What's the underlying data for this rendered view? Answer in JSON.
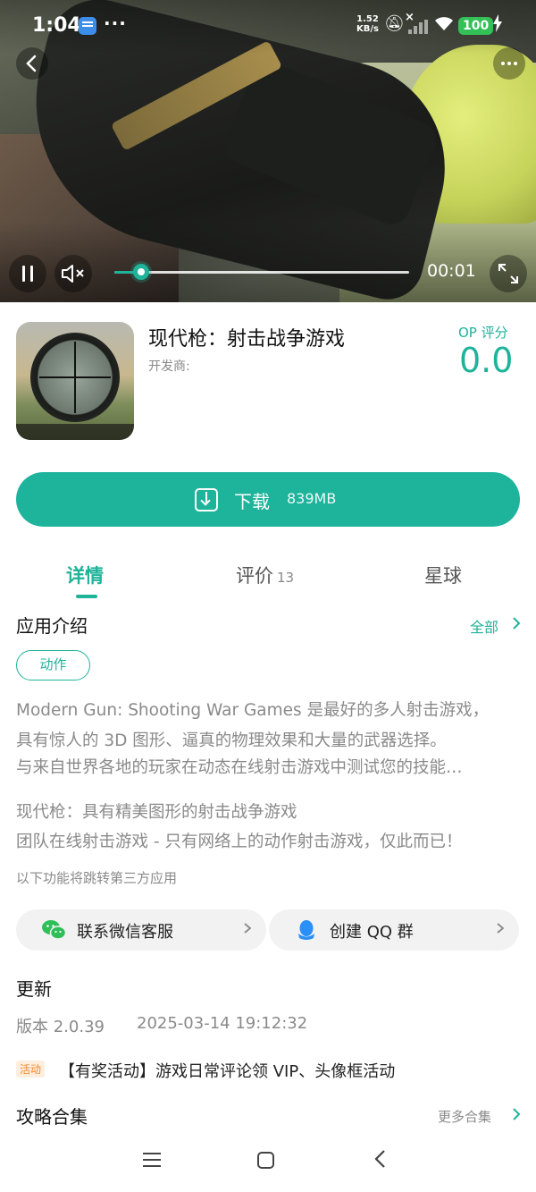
{
  "status_bar": {
    "time": "1:04",
    "net_speed_value": "1.52",
    "net_speed_unit": "KB/s",
    "battery": "100",
    "more_dots": "···"
  },
  "video": {
    "time": "00:01",
    "progress_fraction": 0.09
  },
  "app": {
    "title": "现代枪：射击战争游戏",
    "developer_label": "开发商:",
    "score_label": "OP 评分",
    "score_value": "0.0"
  },
  "download": {
    "label": "下载",
    "size": "839MB"
  },
  "tabs": [
    {
      "label": "详情",
      "count": ""
    },
    {
      "label": "评价",
      "count": "13"
    },
    {
      "label": "星球",
      "count": ""
    }
  ],
  "intro": {
    "title": "应用介绍",
    "see_all": "全部",
    "tag": "动作",
    "description_lines": [
      "Modern Gun: Shooting War Games 是最好的多人射击游戏，",
      "具有惊人的 3D 图形、逼真的物理效果和大量的武器选择。",
      "与来自世界各地的玩家在动态在线射击游戏中测试您的技能…"
    ],
    "extra_lines": [
      "现代枪：具有精美图形的射击战争游戏",
      "团队在线射击游戏 - 只有网络上的动作射击游戏，仅此而已！"
    ],
    "third_party_note": "以下功能将跳转第三方应用"
  },
  "services": {
    "wechat_label": "联系微信客服",
    "qq_label": "创建 QQ 群"
  },
  "update": {
    "title": "更新",
    "version": "版本 2.0.39",
    "date": "2025-03-14 19:12:32"
  },
  "promo": {
    "tag": "活动",
    "text": "【有奖活动】游戏日常评论领 VIP、头像框活动"
  },
  "guides": {
    "title": "攻略合集",
    "more": "更多合集"
  },
  "colors": {
    "accent": "#1eb39b",
    "promo": "#f08a2c",
    "battery": "#33c157"
  },
  "icons": {
    "back": "chevron-left-icon",
    "more": "more-horizontal-icon",
    "pause": "pause-icon",
    "mute": "volume-mute-icon",
    "fullscreen": "fullscreen-icon",
    "download": "download-icon",
    "wechat": "wechat-icon",
    "qq": "qq-icon"
  }
}
